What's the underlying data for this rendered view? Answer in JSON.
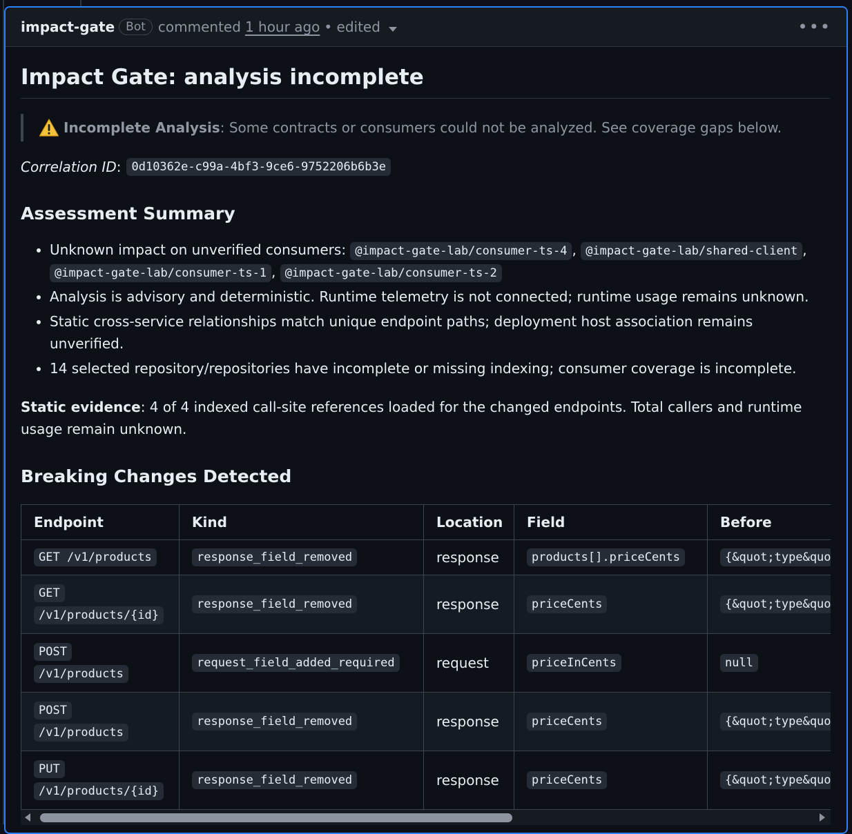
{
  "header": {
    "author": "impact-gate",
    "badge": "Bot",
    "action": "commented",
    "time": "1 hour ago",
    "edited": "• edited",
    "more": "•••"
  },
  "title": "Impact Gate: analysis incomplete",
  "warning": {
    "icon": "warning-icon",
    "strong": "Incomplete Analysis",
    "text": ": Some contracts or consumers could not be analyzed. See coverage gaps below."
  },
  "correlation": {
    "label": "Correlation ID",
    "colon": ":",
    "value": "0d10362e-c99a-4bf3-9ce6-9752206b6b3e"
  },
  "summary": {
    "heading": "Assessment Summary",
    "item1_text": "Unknown impact on unverified consumers:",
    "consumers": [
      "@impact-gate-lab/consumer-ts-4",
      "@impact-gate-lab/shared-client",
      "@impact-gate-lab/consumer-ts-1",
      "@impact-gate-lab/consumer-ts-2"
    ],
    "sep": ",",
    "item2": "Analysis is advisory and deterministic. Runtime telemetry is not connected; runtime usage remains unknown.",
    "item3": "Static cross-service relationships match unique endpoint paths; deployment host association remains unverified.",
    "item4": "14 selected repository/repositories have incomplete or missing indexing; consumer coverage is incomplete."
  },
  "evidence": {
    "label": "Static evidence",
    "text": ": 4 of 4 indexed call-site references loaded for the changed endpoints. Total callers and runtime usage remain unknown."
  },
  "breaking": {
    "heading": "Breaking Changes Detected",
    "columns": [
      "Endpoint",
      "Kind",
      "Location",
      "Field",
      "Before"
    ],
    "rows": [
      {
        "method": "GET",
        "path": "/v1/products",
        "kind": "response_field_removed",
        "location": "response",
        "field": "products[].priceCents",
        "before": "{&quot;type&quot;:&quot;integer&quot;}"
      },
      {
        "method": "GET",
        "path": "/v1/products/{id}",
        "kind": "response_field_removed",
        "location": "response",
        "field": "priceCents",
        "before": "{&quot;type&quot;:&quot;integer&quot;}"
      },
      {
        "method": "POST",
        "path": "/v1/products",
        "kind": "request_field_added_required",
        "location": "request",
        "field": "priceInCents",
        "before": "null"
      },
      {
        "method": "POST",
        "path": "/v1/products",
        "kind": "response_field_removed",
        "location": "response",
        "field": "priceCents",
        "before": "{&quot;type&quot;:&quot;integer&quot;}"
      },
      {
        "method": "PUT",
        "path": "/v1/products/{id}",
        "kind": "response_field_removed",
        "location": "response",
        "field": "priceCents",
        "before": "{&quot;type&quot;:&quot;integer&quot;}"
      }
    ]
  }
}
